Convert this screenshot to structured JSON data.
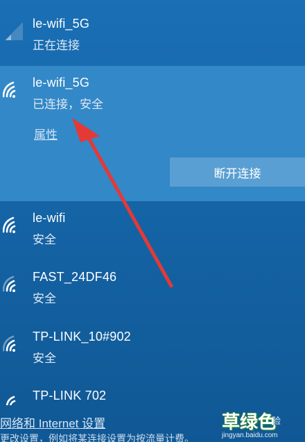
{
  "networks": [
    {
      "name": "le-wifi_5G",
      "status": "正在连接",
      "icon": "wifi-signal-icon"
    },
    {
      "name": "le-wifi_5G",
      "status": "已连接，安全",
      "icon": "wifi-signal-icon",
      "properties_label": "属性",
      "disconnect_label": "断开连接"
    },
    {
      "name": "le-wifi",
      "status": "安全",
      "icon": "wifi-signal-icon"
    },
    {
      "name": "FAST_24DF46",
      "status": "安全",
      "icon": "wifi-signal-icon"
    },
    {
      "name": "TP-LINK_10#902",
      "status": "安全",
      "icon": "wifi-signal-icon"
    },
    {
      "name": "TP-LINK 702",
      "icon": "wifi-signal-icon"
    }
  ],
  "footer": {
    "settings_link": "网络和 Internet 设置",
    "settings_desc": "更改设置，例如将某连接设置为按流量计费。"
  },
  "watermark": {
    "main": "草绿色",
    "side": "验",
    "sub": "jingyan.baidu.com"
  },
  "colors": {
    "background": "#1565a8",
    "connected_highlight": "#3388c7",
    "disconnect_button": "#5a9fd3",
    "arrow": "#e53935"
  }
}
